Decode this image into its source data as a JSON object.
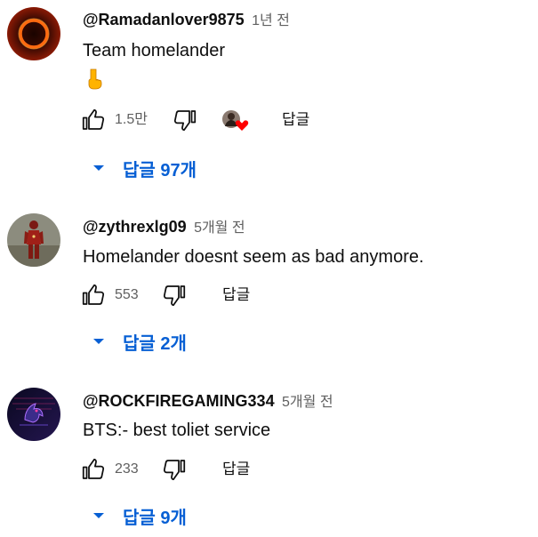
{
  "colors": {
    "link_blue": "#065fd4",
    "text_primary": "#0f0f0f",
    "text_secondary": "#606060",
    "heart_red": "#ff0000"
  },
  "comments": [
    {
      "author": "@Ramadanlover9875",
      "time": "1년 전",
      "text": "Team homelander",
      "emoji": "👇",
      "likes": "1.5만",
      "reply_label": "답글",
      "creator_heart": true,
      "replies_label": "답글 97개",
      "avatar_icon": "solar-eclipse-ring-avatar"
    },
    {
      "author": "@zythrexlg09",
      "time": "5개월 전",
      "text": "Homelander doesnt seem as bad anymore.",
      "likes": "553",
      "reply_label": "답글",
      "creator_heart": false,
      "replies_label": "답글 2개",
      "avatar_icon": "red-armored-figure-avatar"
    },
    {
      "author": "@ROCKFIREGAMING334",
      "time": "5개월 전",
      "text": "BTS:- best toliet service",
      "likes": "233",
      "reply_label": "답글",
      "creator_heart": false,
      "replies_label": "답글 9개",
      "avatar_icon": "rfg-gaming-logo-avatar"
    }
  ]
}
